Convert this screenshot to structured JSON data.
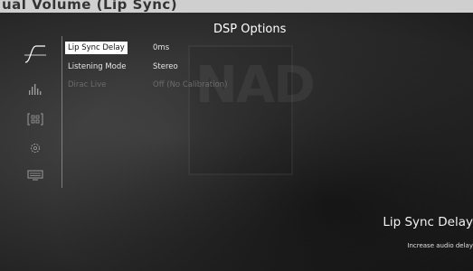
{
  "top_strip": {
    "text": "ual Volume (Lip Sync)"
  },
  "header": {
    "title": "DSP Options"
  },
  "watermark": {
    "text": "NAD"
  },
  "sidebar": {
    "items": [
      {
        "icon": "waveform-icon",
        "active": true
      },
      {
        "icon": "equalizer-icon",
        "active": false
      },
      {
        "icon": "speaker-layout-icon",
        "active": false
      },
      {
        "icon": "settings-gear-icon",
        "active": false
      },
      {
        "icon": "display-icon",
        "active": false
      }
    ]
  },
  "menu": {
    "items": [
      {
        "label": "Lip Sync Delay",
        "value": "0ms",
        "selected": true,
        "disabled": false
      },
      {
        "label": "Listening Mode",
        "value": "Stereo",
        "selected": false,
        "disabled": false
      },
      {
        "label": "Dirac Live",
        "value": "Off (No Calibration)",
        "selected": false,
        "disabled": true
      }
    ]
  },
  "info": {
    "title": "Lip Sync Delay",
    "description": "Increase audio delay"
  },
  "colors": {
    "text": "#e6e6e6",
    "selected_bg": "#ffffff",
    "disabled_text": "#6c6c6c",
    "background": "#2e2e2e"
  }
}
